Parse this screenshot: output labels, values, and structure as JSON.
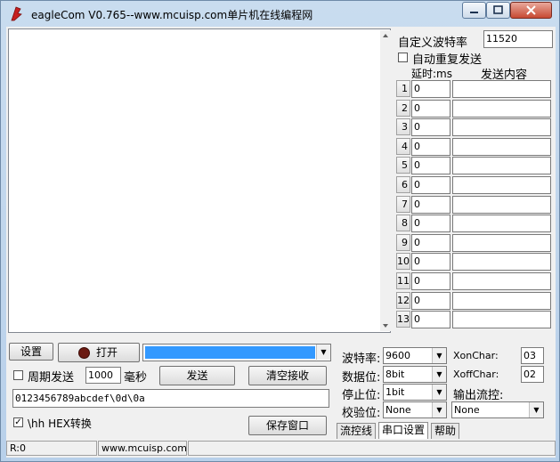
{
  "window": {
    "title": "eagleCom V0.765--www.mcuisp.com单片机在线编程网"
  },
  "right_panel": {
    "baud_label": "自定义波特率",
    "baud_value": "11520",
    "auto_resend_label": "自动重复发送",
    "delay_header": "延时:ms",
    "content_header": "发送内容",
    "rows": [
      {
        "index": "1",
        "delay": "0",
        "content": ""
      },
      {
        "index": "2",
        "delay": "0",
        "content": ""
      },
      {
        "index": "3",
        "delay": "0",
        "content": ""
      },
      {
        "index": "4",
        "delay": "0",
        "content": ""
      },
      {
        "index": "5",
        "delay": "0",
        "content": ""
      },
      {
        "index": "6",
        "delay": "0",
        "content": ""
      },
      {
        "index": "7",
        "delay": "0",
        "content": ""
      },
      {
        "index": "8",
        "delay": "0",
        "content": ""
      },
      {
        "index": "9",
        "delay": "0",
        "content": ""
      },
      {
        "index": "10",
        "delay": "0",
        "content": ""
      },
      {
        "index": "11",
        "delay": "0",
        "content": ""
      },
      {
        "index": "12",
        "delay": "0",
        "content": ""
      },
      {
        "index": "13",
        "delay": "0",
        "content": ""
      }
    ]
  },
  "controls": {
    "settings_label": "设置",
    "open_label": "打开",
    "port_value": "",
    "periodic_label": "周期发送",
    "period_value": "1000",
    "ms_label": "毫秒",
    "send_label": "发送",
    "clear_label": "清空接收",
    "send_text": "0123456789abcdef\\0d\\0a",
    "hex_label": "\\hh HEX转换",
    "save_label": "保存窗口"
  },
  "serial": {
    "baud_label": "波特率:",
    "baud_value": "9600",
    "data_label": "数据位:",
    "data_value": "8bit",
    "stop_label": "停止位:",
    "stop_value": "1bit",
    "parity_label": "校验位:",
    "parity_value": "None",
    "xon_label": "XonChar:",
    "xon_value": "03",
    "xoff_label": "XoffChar:",
    "xoff_value": "02",
    "flow_label": "输出流控:",
    "flow_value": "None"
  },
  "tabs": [
    "流控线",
    "串口设置",
    "帮助"
  ],
  "status": {
    "rx": "R:0",
    "site": "www.mcuisp.com"
  },
  "colors": {
    "accent": "#3399ff",
    "title_close": "#c74a33"
  }
}
